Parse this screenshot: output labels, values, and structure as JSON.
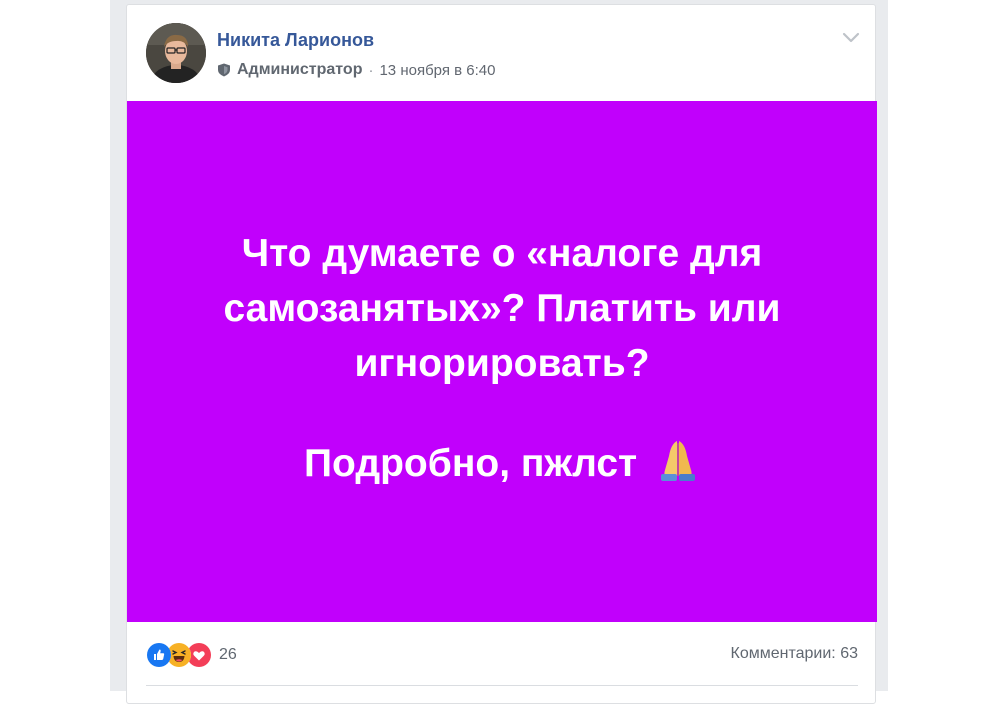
{
  "post": {
    "author": "Никита Ларионов",
    "role": "Администратор",
    "separator": "·",
    "timestamp": "13 ноября в 6:40",
    "text_line_1": "Что думаете о «налоге для",
    "text_line_2": "самозанятых»? Платить или",
    "text_line_3": "игнорировать?",
    "text_line_4": "Подробно, пжлст",
    "background_color": "#c100fc",
    "emoji_icon": "folded-hands-icon"
  },
  "reactions": {
    "icons": [
      "like-icon",
      "haha-icon",
      "love-icon"
    ],
    "count": "26"
  },
  "comments": {
    "label": "Комментарии: 63"
  },
  "colors": {
    "author_link": "#365899",
    "meta_text": "#616770",
    "like_blue": "#1877f2",
    "haha_yellow": "#f7b125",
    "love_red": "#f33e58"
  }
}
